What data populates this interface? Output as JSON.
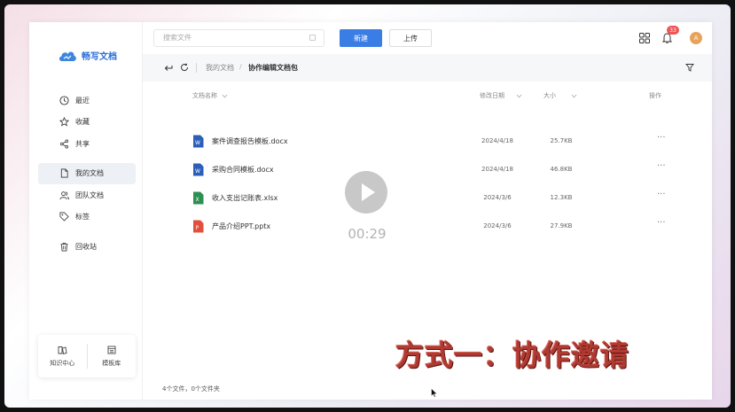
{
  "app": {
    "logo_text": "畅写文档"
  },
  "header": {
    "search_placeholder": "搜索文件",
    "new_label": "新建",
    "upload_label": "上传",
    "notification_count": "33",
    "avatar_letter": "A"
  },
  "sidebar": {
    "items": [
      {
        "label": "最近",
        "icon": "clock-icon"
      },
      {
        "label": "收藏",
        "icon": "star-icon"
      },
      {
        "label": "共享",
        "icon": "share-icon"
      },
      {
        "label": "我的文档",
        "icon": "file-icon",
        "active": true
      },
      {
        "label": "团队文档",
        "icon": "users-icon"
      },
      {
        "label": "标签",
        "icon": "tag-icon"
      },
      {
        "label": "回收站",
        "icon": "trash-icon"
      }
    ],
    "bottom": [
      {
        "label": "知识中心",
        "icon": "book-icon"
      },
      {
        "label": "模板库",
        "icon": "template-icon"
      }
    ]
  },
  "toolbar": {
    "breadcrumb": [
      "我的文档",
      "协作编辑文档包"
    ],
    "separator": "/"
  },
  "table": {
    "columns": {
      "name": "文档名称",
      "date": "修改日期",
      "size": "大小",
      "actions": "操作"
    },
    "rows": [
      {
        "name": "案件调查报告模板.docx",
        "date": "2024/4/18",
        "size": "25.7KB",
        "type": "word",
        "color": "#2b5fb8"
      },
      {
        "name": "采购合同模板.docx",
        "date": "2024/4/18",
        "size": "46.8KB",
        "type": "word",
        "color": "#2b5fb8"
      },
      {
        "name": "收入支出记账表.xlsx",
        "date": "2024/3/6",
        "size": "12.3KB",
        "type": "excel",
        "color": "#2d8f52"
      },
      {
        "name": "产品介绍PPT.pptx",
        "date": "2024/3/6",
        "size": "27.9KB",
        "type": "ppt",
        "color": "#e2503b"
      }
    ],
    "more_label": "···"
  },
  "footer": {
    "count_text": "4个文件，0个文件夹"
  },
  "video": {
    "timer": "00:29",
    "caption": "方式一：协作邀请"
  },
  "colors": {
    "primary": "#3a7de4",
    "badge": "#f05454",
    "caption": "#b03a32"
  }
}
